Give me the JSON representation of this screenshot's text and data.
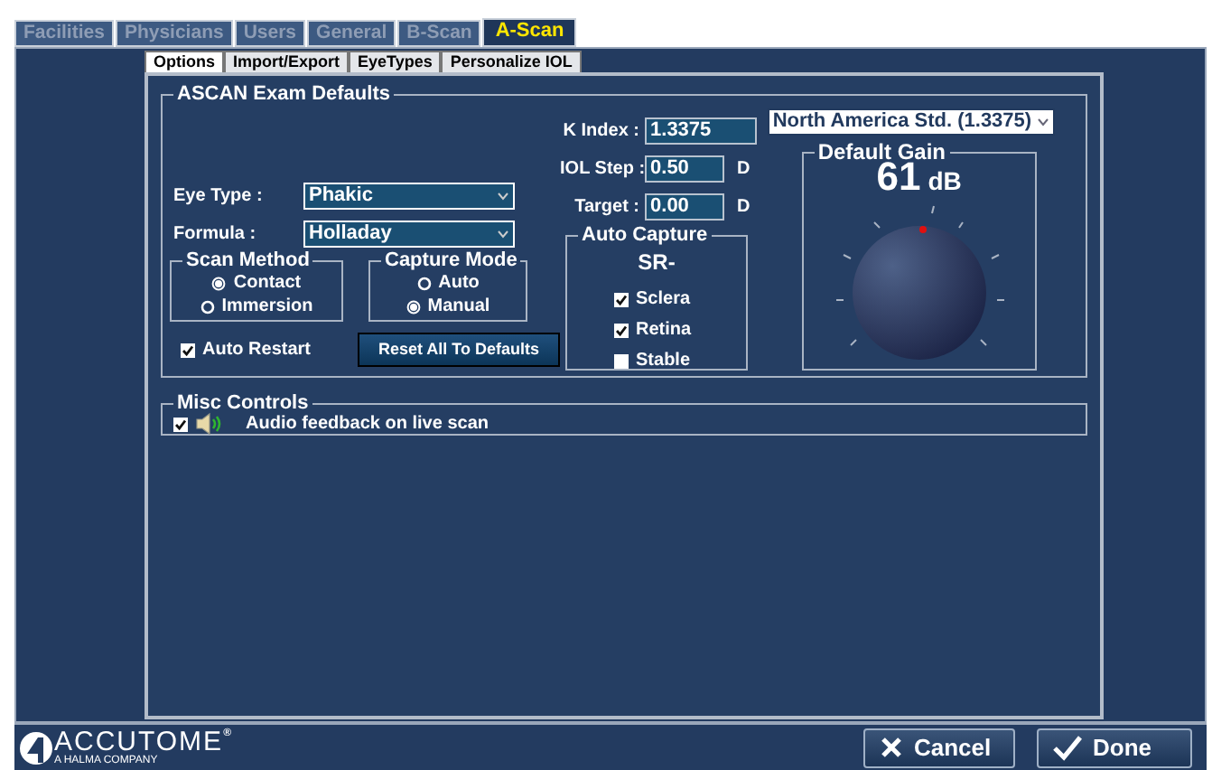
{
  "top_tabs": [
    {
      "label": "Facilities",
      "selected": false
    },
    {
      "label": "Physicians",
      "selected": false
    },
    {
      "label": "Users",
      "selected": false
    },
    {
      "label": "General",
      "selected": false
    },
    {
      "label": "B-Scan",
      "selected": false
    },
    {
      "label": "A-Scan",
      "selected": true
    }
  ],
  "sub_tabs": [
    {
      "label": "Options",
      "selected": true
    },
    {
      "label": "Import/Export",
      "selected": false
    },
    {
      "label": "EyeTypes",
      "selected": false
    },
    {
      "label": "Personalize IOL",
      "selected": false
    }
  ],
  "exam_defaults": {
    "title": "ASCAN Exam Defaults",
    "k_index": {
      "label": "K Index :",
      "value": "1.3375"
    },
    "iol_step": {
      "label": "IOL Step :",
      "value": "0.50",
      "unit": "D"
    },
    "target": {
      "label": "Target :",
      "value": "0.00",
      "unit": "D"
    },
    "k_standard": {
      "value": "North America Std. (1.3375)"
    },
    "eye_type": {
      "label": "Eye Type :",
      "value": "Phakic"
    },
    "formula": {
      "label": "Formula :",
      "value": "Holladay"
    },
    "scan_method": {
      "title": "Scan Method",
      "options": [
        {
          "label": "Contact",
          "selected": true
        },
        {
          "label": "Immersion",
          "selected": false
        }
      ]
    },
    "capture_mode": {
      "title": "Capture Mode",
      "options": [
        {
          "label": "Auto",
          "selected": false
        },
        {
          "label": "Manual",
          "selected": true
        }
      ]
    },
    "auto_restart": {
      "label": "Auto Restart",
      "checked": true
    },
    "reset_button": "Reset All To Defaults",
    "auto_capture": {
      "title": "Auto Capture",
      "mode": "SR-",
      "options": [
        {
          "label": "Sclera",
          "checked": true
        },
        {
          "label": "Retina",
          "checked": true
        },
        {
          "label": "Stable",
          "checked": false
        }
      ]
    },
    "default_gain": {
      "title": "Default Gain",
      "value": "61",
      "unit": "dB"
    }
  },
  "misc_controls": {
    "title": "Misc Controls",
    "audio_feedback": {
      "label": "Audio feedback on live scan",
      "checked": true
    }
  },
  "footer": {
    "logo": "ACCUTOME",
    "trademark": "®",
    "tagline": "A HALMA COMPANY",
    "buttons": [
      {
        "label": "Cancel",
        "kind": "cancel"
      },
      {
        "label": "Done",
        "kind": "done"
      }
    ]
  }
}
